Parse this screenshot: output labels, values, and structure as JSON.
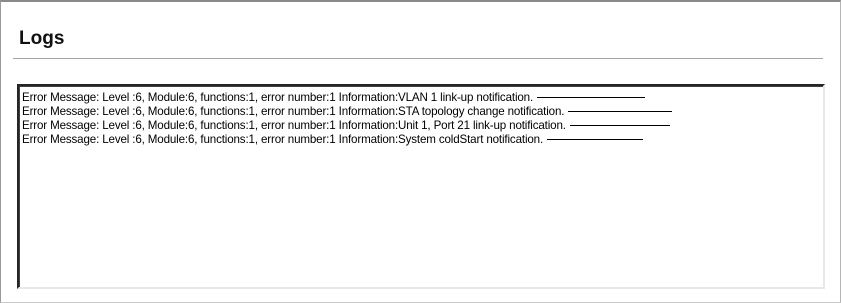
{
  "page": {
    "title": "Logs"
  },
  "logs": {
    "entries": [
      {
        "text": "Error Message: Level :6, Module:6, functions:1, error number:1 Information:VLAN 1 link-up notification."
      },
      {
        "text": "Error Message: Level :6, Module:6, functions:1, error number:1 Information:STA topology change notification."
      },
      {
        "text": "Error Message: Level :6, Module:6, functions:1, error number:1 Information:Unit 1, Port 21 link-up notification."
      },
      {
        "text": "Error Message: Level :6, Module:6, functions:1, error number:1 Information:System coldStart notification."
      }
    ]
  }
}
